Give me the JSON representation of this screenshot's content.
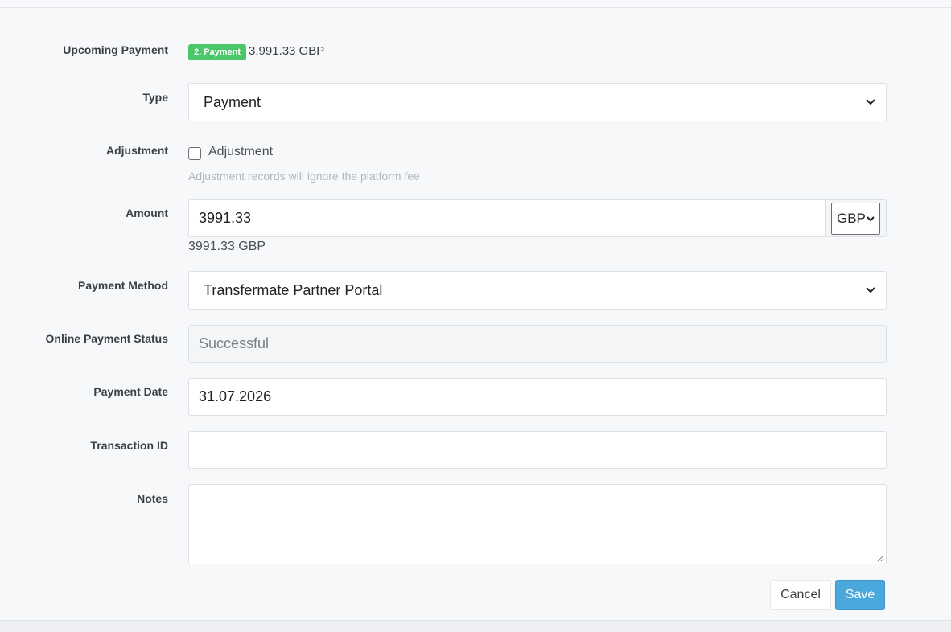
{
  "form": {
    "upcoming_payment": {
      "label": "Upcoming Payment",
      "badge": "2. Payment",
      "amount": "3,991.33 GBP",
      "badge_color": "#4cc66b"
    },
    "type": {
      "label": "Type",
      "value": "Payment"
    },
    "adjustment": {
      "label": "Adjustment",
      "checkbox_label": "Adjustment",
      "checked": false,
      "help": "Adjustment records will ignore the platform fee"
    },
    "amount": {
      "label": "Amount",
      "value": "3991.33",
      "currency": "GBP",
      "summary": "3991.33 GBP"
    },
    "payment_method": {
      "label": "Payment Method",
      "value": "Transfermate Partner Portal"
    },
    "online_payment_status": {
      "label": "Online Payment Status",
      "value": "Successful"
    },
    "payment_date": {
      "label": "Payment Date",
      "value": "31.07.2026"
    },
    "transaction_id": {
      "label": "Transaction ID",
      "value": ""
    },
    "notes": {
      "label": "Notes",
      "value": ""
    }
  },
  "actions": {
    "cancel_label": "Cancel",
    "save_label": "Save",
    "save_color": "#4aa8dc"
  },
  "icons": {
    "select_arrow": "chevron-down-icon",
    "textarea_resize": "resize-grip-icon"
  }
}
